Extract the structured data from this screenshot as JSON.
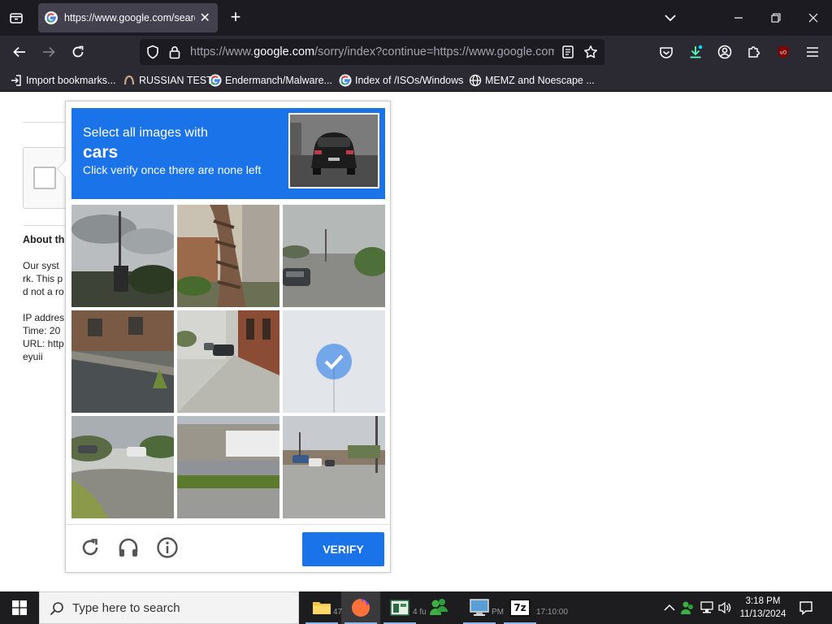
{
  "browser": {
    "tab": {
      "title": "https://www.google.com/search?",
      "close_glyph": "✕",
      "favicon": "google-icon"
    },
    "new_tab_glyph": "+",
    "url": {
      "prefix": "https://www.",
      "host": "google.com",
      "rest": "/sorry/index?continue=https://www.google.com/s"
    },
    "bookmarks": [
      {
        "label": "Import bookmarks...",
        "icon": "import-icon"
      },
      {
        "label": "RUSSIAN TEST",
        "icon": "site-icon"
      },
      {
        "label": "Endermanch/Malware...",
        "icon": "google-icon"
      },
      {
        "label": "Index of /ISOs/Windows",
        "icon": "google-icon"
      },
      {
        "label": "MEMZ and Noescape ...",
        "icon": "globe-icon"
      }
    ],
    "extension_badge": "uO",
    "accent": "#1a73e8"
  },
  "page": {
    "about_title": "About th",
    "lines": [
      "Our syst",
      "rk. This p",
      "d not a ro",
      "IP addres",
      "Time: 20",
      "URL: http",
      "eyuii"
    ]
  },
  "captcha": {
    "instruction": "Select all images with",
    "target": "cars",
    "hint": "Click verify once there are none left",
    "tiles": [
      {
        "scene": "cloudy street with pole",
        "selected": false
      },
      {
        "scene": "palm tree trunk",
        "selected": false
      },
      {
        "scene": "road with car",
        "selected": false
      },
      {
        "scene": "brick building",
        "selected": false
      },
      {
        "scene": "sidewalk with cars",
        "selected": false
      },
      {
        "scene": "loading selected tile",
        "selected": true
      },
      {
        "scene": "curved road",
        "selected": false
      },
      {
        "scene": "warehouse and road",
        "selected": false
      },
      {
        "scene": "intersection with cars",
        "selected": false
      }
    ],
    "verify_label": "VERIFY",
    "icons": [
      "reload-icon",
      "audio-icon",
      "info-icon"
    ]
  },
  "taskbar": {
    "search_placeholder": "Type here to search",
    "ghost_text": [
      "47",
      "4 fu",
      "PM",
      "17:10:00"
    ],
    "time": "3:18 PM",
    "date": "11/13/2024",
    "apps": [
      "file-explorer-icon",
      "firefox-icon",
      "task-view-icon",
      "green-people-icon",
      "computer-icon",
      "7zip-icon"
    ],
    "seven_zip_label": "7z"
  }
}
